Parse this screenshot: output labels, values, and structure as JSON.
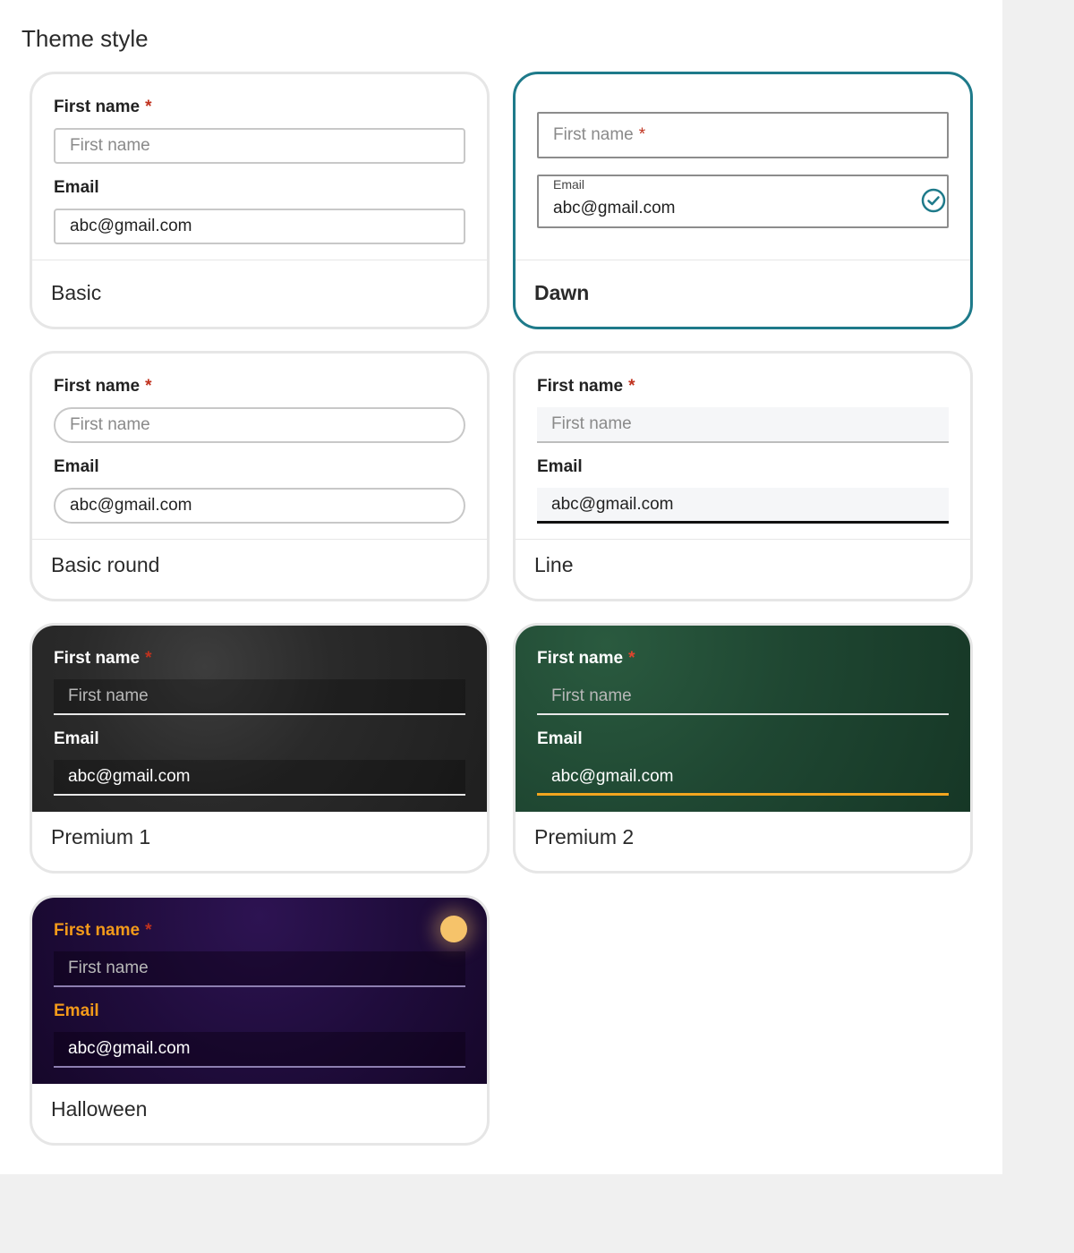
{
  "section_title": "Theme style",
  "colors": {
    "selected_border": "#1e7a8a",
    "required": "#c0321e",
    "premium2_accent": "#f2a51f",
    "halloween_label": "#f39a1a"
  },
  "form": {
    "first_name_label": "First name",
    "required_mark": "*",
    "first_name_placeholder": "First name",
    "email_label": "Email",
    "email_value": "abc@gmail.com"
  },
  "themes": [
    {
      "name": "Basic",
      "selected": false
    },
    {
      "name": "Dawn",
      "selected": true,
      "icon": "check-circle-icon"
    },
    {
      "name": "Basic round",
      "selected": false
    },
    {
      "name": "Line",
      "selected": false
    },
    {
      "name": "Premium 1",
      "selected": false
    },
    {
      "name": "Premium 2",
      "selected": false
    },
    {
      "name": "Halloween",
      "selected": false,
      "icon": "moon-icon"
    }
  ]
}
